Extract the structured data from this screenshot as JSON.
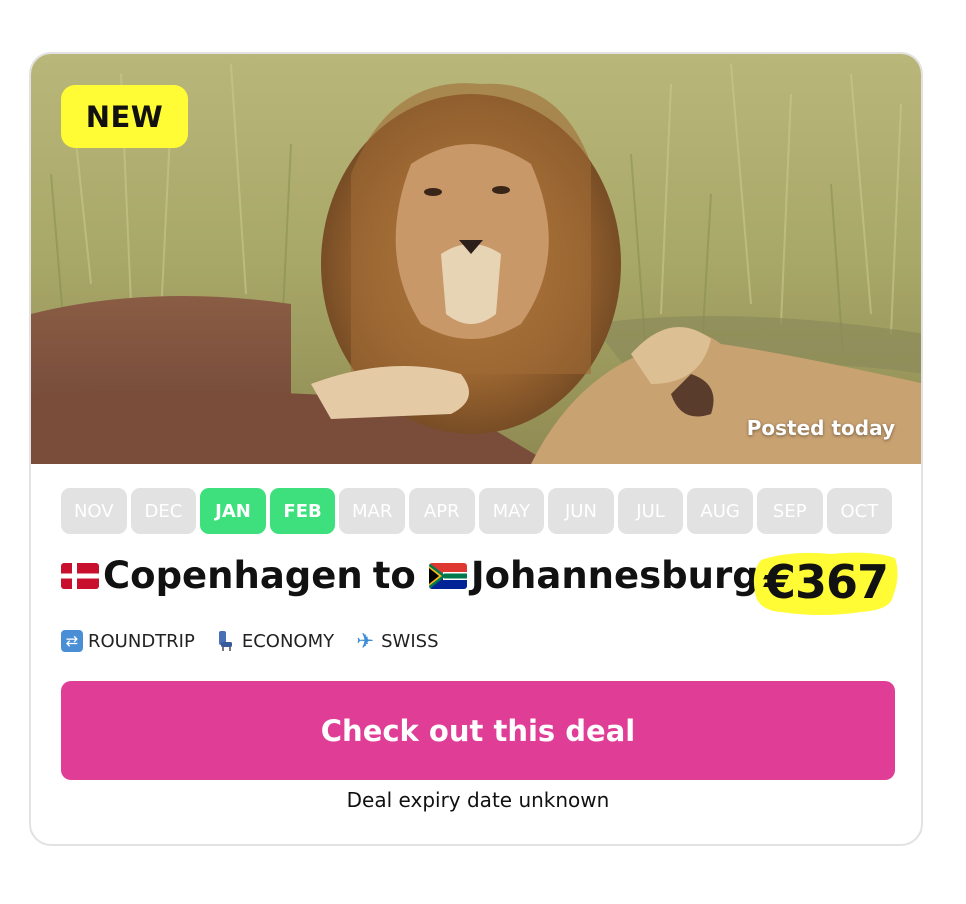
{
  "badge": {
    "label": "NEW",
    "color": "#fffb34"
  },
  "hero": {
    "posted_label": "Posted today"
  },
  "months": [
    {
      "label": "NOV",
      "active": false
    },
    {
      "label": "DEC",
      "active": false
    },
    {
      "label": "JAN",
      "active": true
    },
    {
      "label": "FEB",
      "active": true
    },
    {
      "label": "MAR",
      "active": false
    },
    {
      "label": "APR",
      "active": false
    },
    {
      "label": "MAY",
      "active": false
    },
    {
      "label": "JUN",
      "active": false
    },
    {
      "label": "JUL",
      "active": false
    },
    {
      "label": "AUG",
      "active": false
    },
    {
      "label": "SEP",
      "active": false
    },
    {
      "label": "OCT",
      "active": false
    }
  ],
  "route": {
    "origin": "Copenhagen",
    "connector": "to",
    "destination": "Johannesburg",
    "origin_flag_icon": "denmark-flag-icon",
    "destination_flag_icon": "south-africa-flag-icon"
  },
  "price": {
    "value": "€367",
    "highlight_color": "#fffb34"
  },
  "tags": [
    {
      "icon": "roundtrip-icon",
      "label": "ROUNDTRIP"
    },
    {
      "icon": "seat-icon",
      "label": "ECONOMY"
    },
    {
      "icon": "airplane-icon",
      "label": "SWISS"
    }
  ],
  "cta": {
    "label": "Check out this deal",
    "color": "#e03e96"
  },
  "expiry_text": "Deal expiry date unknown",
  "colors": {
    "month_active": "#3de07c",
    "month_inactive": "#e2e2e2"
  }
}
